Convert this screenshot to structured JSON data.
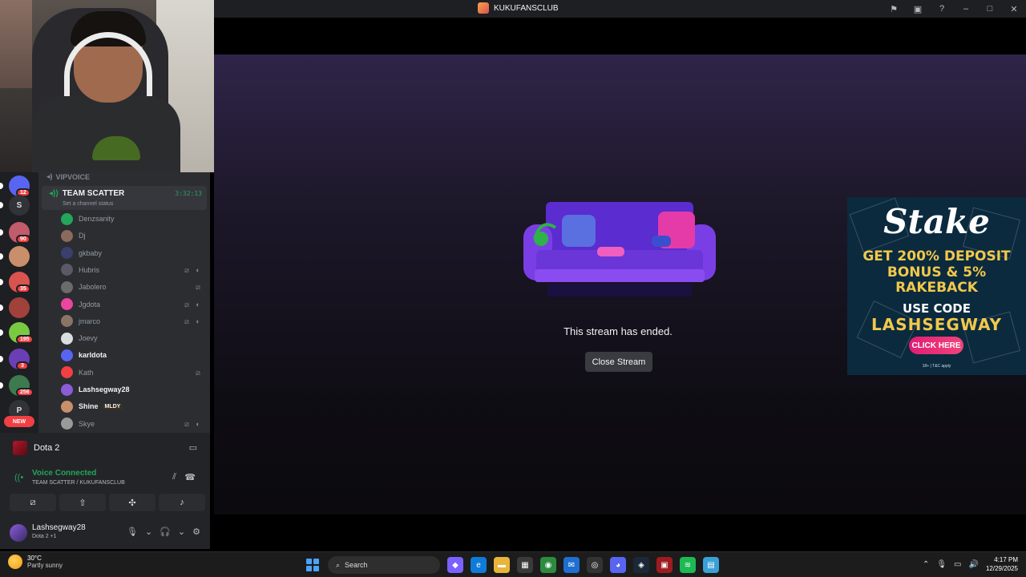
{
  "window": {
    "title": "KUKUFANSCLUB",
    "icons": [
      "inbox-icon",
      "stream-icon",
      "help-icon",
      "minimize-icon",
      "maximize-icon",
      "close-icon"
    ]
  },
  "stream": {
    "ended_message": "This stream has ended.",
    "close_button": "Close Stream"
  },
  "ad": {
    "brand": "Stake",
    "line1": "GET 200% DEPOSIT",
    "line2": "BONUS & 5%",
    "line3": "RAKEBACK",
    "code_label": "USE CODE",
    "code": "LASHSEGWAY",
    "cta": "CLICK HERE",
    "terms": "18+ | T&C apply"
  },
  "server_rail": {
    "servers": [
      {
        "badge": "12",
        "color": "#5865f2"
      },
      {
        "letter": "S",
        "color": "#313338"
      },
      {
        "badge": "90",
        "color": "#c25b6b"
      },
      {
        "badge": "",
        "color": "#c98f6a"
      },
      {
        "badge": "35",
        "color": "#d9534f"
      },
      {
        "badge": "",
        "color": "#a0413c"
      },
      {
        "badge": "195",
        "color": "#7ac943"
      },
      {
        "badge": "3",
        "color": "#6a3fb5"
      },
      {
        "badge": "256",
        "color": "#3e7a4f"
      },
      {
        "letter": "P",
        "color": "#313338"
      }
    ],
    "new_label": "NEW"
  },
  "channels": {
    "vip_category": "VIPVOICE",
    "active_channel": {
      "name": "TEAM SCATTER",
      "timer": "3:32:13",
      "status_placeholder": "Set a channel status"
    },
    "members": [
      {
        "name": "Denzsanity",
        "avatar": "#23a55a",
        "bright": false,
        "muted": false,
        "deafened": false
      },
      {
        "name": "Dj",
        "avatar": "#8a6a5a",
        "bright": false,
        "muted": false,
        "deafened": false
      },
      {
        "name": "gkbaby",
        "avatar": "#3b3f6e",
        "bright": false,
        "muted": false,
        "deafened": false
      },
      {
        "name": "Hubris",
        "avatar": "#5a5a66",
        "bright": false,
        "muted": true,
        "deafened": true
      },
      {
        "name": "Jabolero",
        "avatar": "#6b6b6b",
        "bright": false,
        "muted": true,
        "deafened": false
      },
      {
        "name": "Jgdota",
        "avatar": "#eb459e",
        "bright": false,
        "muted": true,
        "deafened": true
      },
      {
        "name": "jmarco",
        "avatar": "#8a7466",
        "bright": false,
        "muted": true,
        "deafened": true
      },
      {
        "name": "Joevy",
        "avatar": "#dbdee1",
        "bright": false,
        "muted": false,
        "deafened": false
      },
      {
        "name": "karldota",
        "avatar": "#5865f2",
        "bright": true,
        "muted": false,
        "deafened": false
      },
      {
        "name": "Kath",
        "avatar": "#f23f43",
        "bright": false,
        "muted": true,
        "deafened": false
      },
      {
        "name": "Lashsegway28",
        "avatar": "#8a5cd6",
        "bright": true,
        "muted": false,
        "deafened": false
      },
      {
        "name": "Shine",
        "avatar": "#c98f6a",
        "bright": true,
        "muted": false,
        "deafened": false,
        "tag": "MLDY"
      },
      {
        "name": "Skye",
        "avatar": "#9a9a9a",
        "bright": false,
        "muted": true,
        "deafened": true
      }
    ]
  },
  "panel": {
    "game": "Dota 2",
    "voice_status": "Voice Connected",
    "voice_location": "TEAM SCATTER / KUKUFANSCLUB",
    "user": {
      "name": "Lashsegway28",
      "activity": "Dota 2 +1"
    }
  },
  "taskbar": {
    "weather_temp": "30°C",
    "weather_desc": "Partly sunny",
    "search_placeholder": "Search",
    "time": "4:17 PM",
    "date": "12/29/2025",
    "apps": [
      {
        "name": "copilot-icon",
        "color": "#7b61ff",
        "glyph": "◆"
      },
      {
        "name": "edge-icon",
        "color": "#0f7bd8",
        "glyph": "e"
      },
      {
        "name": "file-explorer-icon",
        "color": "#e8b43a",
        "glyph": "▬"
      },
      {
        "name": "store-icon",
        "color": "#3a3a3a",
        "glyph": "▦"
      },
      {
        "name": "chrome-icon",
        "color": "#2c8b3f",
        "glyph": "◉"
      },
      {
        "name": "mail-icon",
        "color": "#1f6fd1",
        "glyph": "✉"
      },
      {
        "name": "recorder-icon",
        "color": "#333",
        "glyph": "◎"
      },
      {
        "name": "discord-icon",
        "color": "#5865f2",
        "glyph": "◕"
      },
      {
        "name": "steam-icon",
        "color": "#1b2838",
        "glyph": "◈"
      },
      {
        "name": "dota-icon",
        "color": "#9e1b20",
        "glyph": "▣"
      },
      {
        "name": "spotify-icon",
        "color": "#1db954",
        "glyph": "≋"
      },
      {
        "name": "notepad-icon",
        "color": "#3aa0d8",
        "glyph": "▤"
      }
    ]
  }
}
